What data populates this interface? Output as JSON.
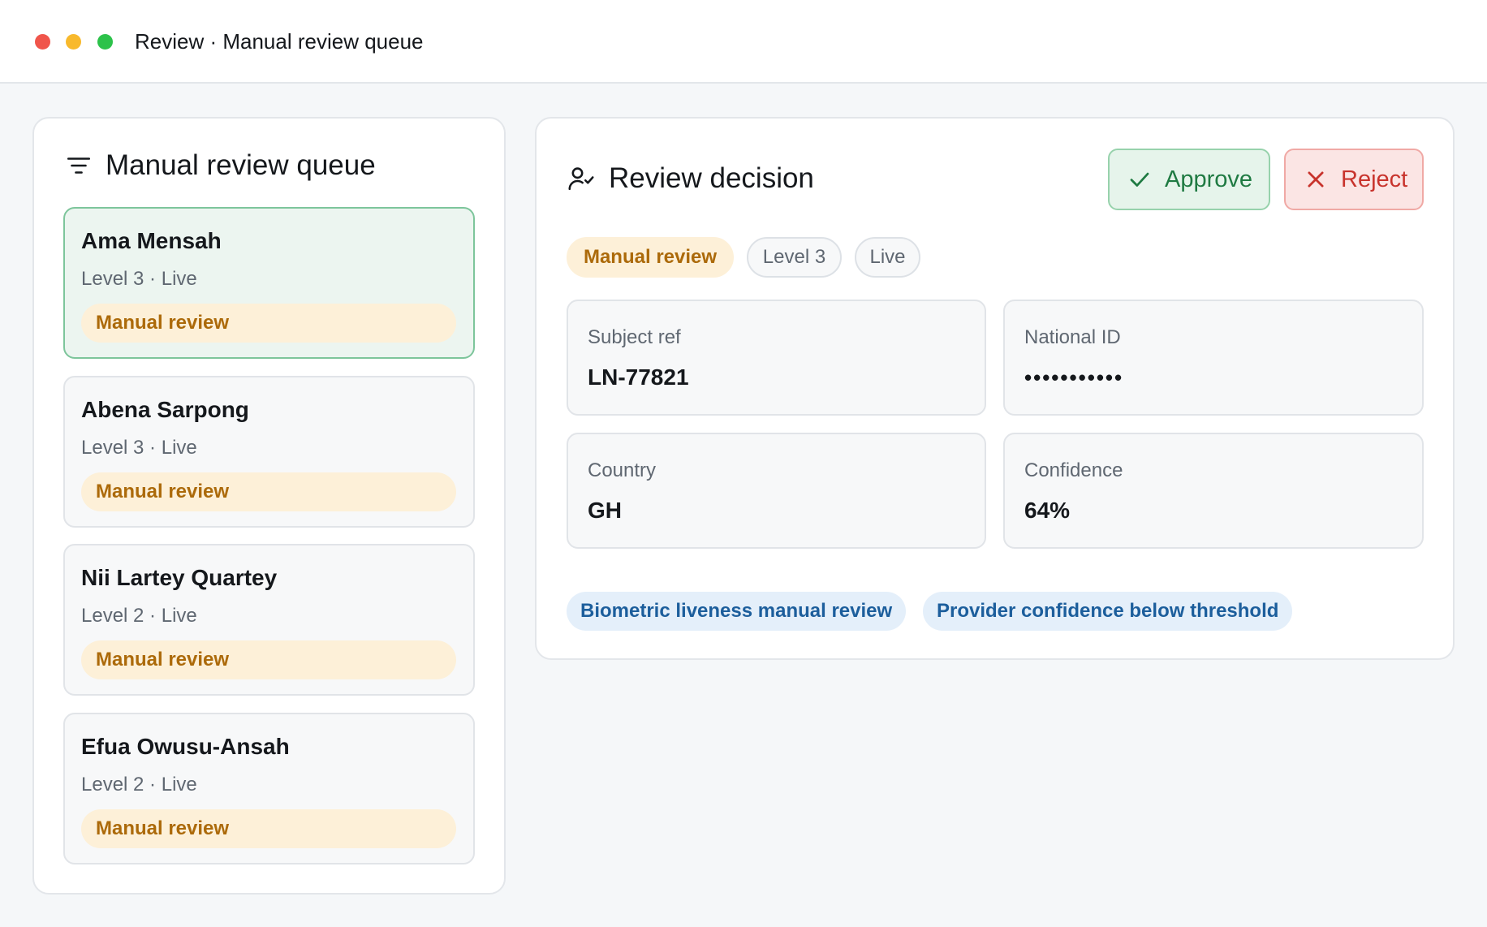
{
  "window": {
    "title": "Review · Manual review queue"
  },
  "queue": {
    "title": "Manual review queue",
    "items": [
      {
        "name": "Ama Mensah",
        "meta": "Level 3 · Live",
        "status": "Manual review",
        "selected": true
      },
      {
        "name": "Abena Sarpong",
        "meta": "Level 3 · Live",
        "status": "Manual review",
        "selected": false
      },
      {
        "name": "Nii Lartey Quartey",
        "meta": "Level 2 · Live",
        "status": "Manual review",
        "selected": false
      },
      {
        "name": "Efua Owusu-Ansah",
        "meta": "Level 2 · Live",
        "status": "Manual review",
        "selected": false
      }
    ]
  },
  "decision": {
    "title": "Review decision",
    "approve_label": "Approve",
    "reject_label": "Reject",
    "tags": {
      "status": "Manual review",
      "level": "Level 3",
      "mode": "Live"
    },
    "fields": [
      {
        "label": "Subject ref",
        "value": "LN-77821"
      },
      {
        "label": "National ID",
        "value": "•••••••••••"
      },
      {
        "label": "Country",
        "value": "GH"
      },
      {
        "label": "Confidence",
        "value": "64%"
      }
    ],
    "reasons": [
      "Biometric liveness manual review",
      "Provider confidence below threshold"
    ]
  },
  "colors": {
    "approve": "#1f7a42",
    "reject": "#c8332c",
    "status_amber": "#ac6a0a",
    "reason_blue": "#1c5e9c",
    "selected_border": "#7dc59b"
  },
  "icons": {
    "queue": "filter-lines-icon",
    "decision": "user-check-icon",
    "approve": "check-icon",
    "reject": "x-icon"
  }
}
